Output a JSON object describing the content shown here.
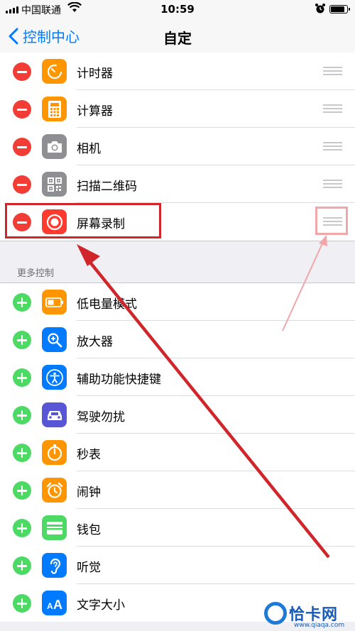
{
  "status_bar": {
    "carrier": "中国联通",
    "time": "10:59"
  },
  "nav": {
    "back_label": "控制中心",
    "title": "自定"
  },
  "included": [
    {
      "label": "计时器",
      "icon": "timer-icon",
      "color": "#ff9500"
    },
    {
      "label": "计算器",
      "icon": "calculator-icon",
      "color": "#ff9500"
    },
    {
      "label": "相机",
      "icon": "camera-icon",
      "color": "#8e8e93"
    },
    {
      "label": "扫描二维码",
      "icon": "qr-code-icon",
      "color": "#8e8e93"
    },
    {
      "label": "屏幕录制",
      "icon": "screen-record-icon",
      "color": "#ff3b30"
    }
  ],
  "section_header": "更多控制",
  "more_controls": [
    {
      "label": "低电量模式",
      "icon": "low-power-icon",
      "color": "#ff9500"
    },
    {
      "label": "放大器",
      "icon": "magnifier-icon",
      "color": "#007aff"
    },
    {
      "label": "辅助功能快捷键",
      "icon": "accessibility-icon",
      "color": "#007aff"
    },
    {
      "label": "驾驶勿扰",
      "icon": "car-icon",
      "color": "#5856d6"
    },
    {
      "label": "秒表",
      "icon": "stopwatch-icon",
      "color": "#ff9500"
    },
    {
      "label": "闹钟",
      "icon": "alarm-clock-icon",
      "color": "#ff9500"
    },
    {
      "label": "钱包",
      "icon": "wallet-icon",
      "color": "#4cd964"
    },
    {
      "label": "听觉",
      "icon": "ear-icon",
      "color": "#007aff"
    },
    {
      "label": "文字大小",
      "icon": "text-size-icon",
      "color": "#007aff"
    }
  ],
  "watermark": {
    "name": "恰卡网",
    "url": "www.qiaqa.com"
  },
  "colors": {
    "accent": "#007aff",
    "remove": "#f23c36",
    "add": "#4cd964",
    "annotation": "#d0252a"
  }
}
